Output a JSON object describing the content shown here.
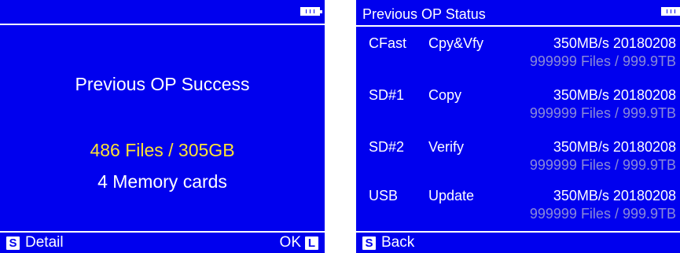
{
  "left": {
    "title": "Previous OP Success",
    "files_summary": "486 Files / 305GB",
    "memory_cards": "4 Memory cards",
    "footer": {
      "key_left": "S",
      "detail_label": "Detail",
      "ok_label": "OK",
      "key_right": "L"
    }
  },
  "right": {
    "title": "Previous OP Status",
    "rows": [
      {
        "device": "CFast",
        "op": "Cpy&Vfy",
        "speed_date": "350MB/s  20180208",
        "files": "999999 Files / 999.9TB"
      },
      {
        "device": "SD#1",
        "op": "Copy",
        "speed_date": "350MB/s  20180208",
        "files": "999999 Files / 999.9TB"
      },
      {
        "device": "SD#2",
        "op": "Verify",
        "speed_date": "350MB/s  20180208",
        "files": "999999 Files / 999.9TB"
      },
      {
        "device": "USB",
        "op": "Update",
        "speed_date": "350MB/s  20180208",
        "files": "999999 Files / 999.9TB"
      }
    ],
    "footer": {
      "key_left": "S",
      "back_label": "Back"
    }
  },
  "icons": {
    "battery": "battery-icon"
  },
  "colors": {
    "screen_bg": "#0000ee",
    "text": "#ffffff",
    "highlight": "#ffe333",
    "muted": "#8a8ad8"
  }
}
